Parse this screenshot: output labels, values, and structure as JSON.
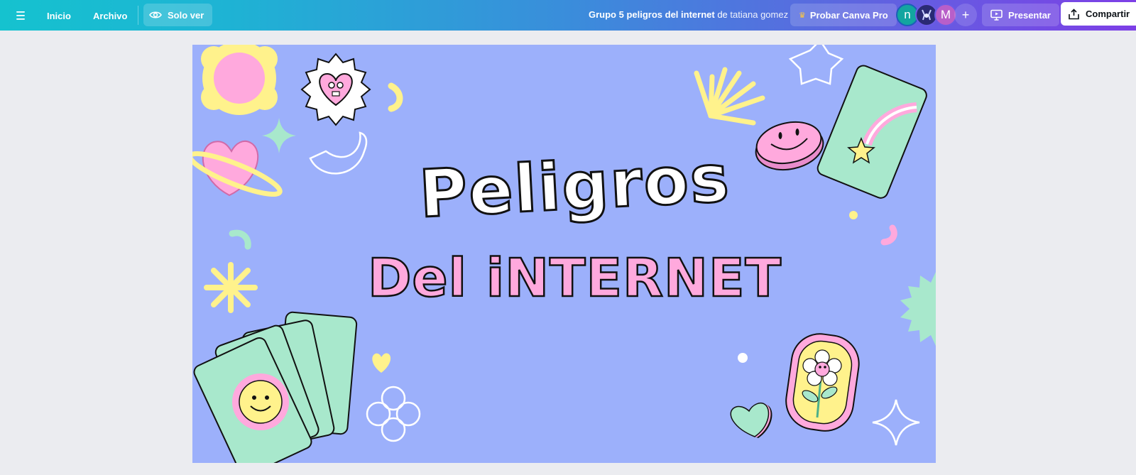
{
  "topbar": {
    "menu_icon": "hamburger-menu-icon",
    "inicio": "Inicio",
    "archivo": "Archivo",
    "view_mode": "Solo ver",
    "view_icon": "eye-icon",
    "doc_title": "Grupo 5 peligros del internet",
    "doc_by": "de",
    "doc_author": "tatiana gomez",
    "pro_label": "Probar Canva Pro",
    "pro_icon": "crown-icon",
    "avatars": [
      "n",
      "",
      "M"
    ],
    "add_collaborator": "+",
    "present_label": "Presentar",
    "present_icon": "presentation-icon",
    "share_label": "Compartir",
    "share_icon": "share-upload-icon"
  },
  "slide": {
    "title_line1": "Peligros",
    "title_line2": "Del iNTERNET",
    "colors": {
      "background": "#9cb0fb",
      "title_fill": "#ffffff",
      "subtitle_fill": "#ffa9dd",
      "mint": "#a8e8cc",
      "yellow": "#fff28c",
      "pink": "#ffa9dd"
    }
  }
}
